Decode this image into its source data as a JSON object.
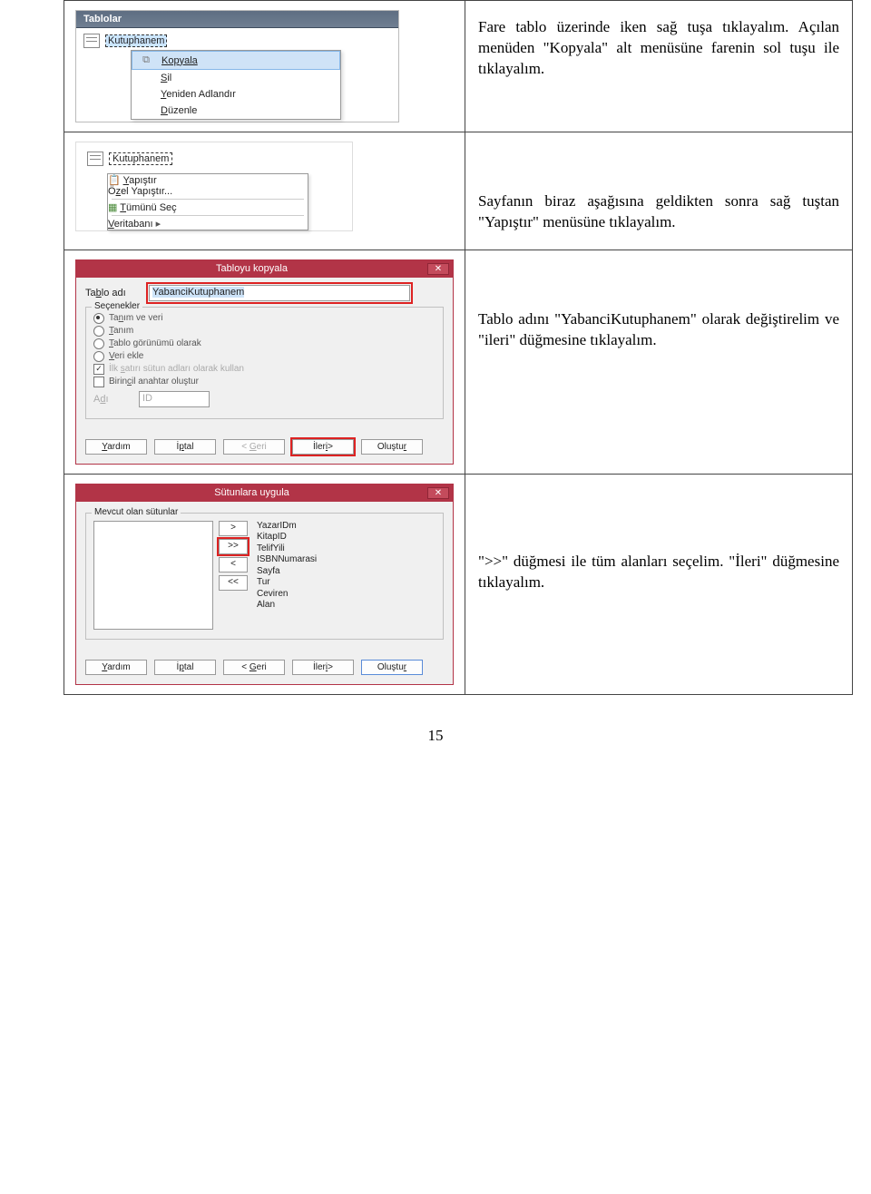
{
  "page_number": "15",
  "row1": {
    "instruction": "Fare tablo üzerinde iken sağ tuşa tıklayalım. Açılan menüden \"Kopyala\" alt menüsüne farenin sol tuşu ile tıklayalım.",
    "header": "Tablolar",
    "tree_item": "Kutuphanem",
    "menu": {
      "copy": "Kopyala",
      "del": "Sil",
      "rename": "Yeniden Adlandır",
      "edit": "Düzenle"
    }
  },
  "row2": {
    "instruction": "Sayfanın biraz aşağısına geldikten sonra sağ tuştan \"Yapıştır\" menüsüne tıklayalım.",
    "tree_item": "Kutuphanem",
    "menu": {
      "paste": "Yapıştır",
      "special": "Özel Yapıştır...",
      "selectall": "Tümünü Seç",
      "db": "Veritabanı"
    }
  },
  "row3": {
    "instruction": "Tablo adını \"YabanciKutuphanem\" olarak değiştirelim ve \"ileri\" düğmesine tıklayalım.",
    "dlg_title": "Tabloyu kopyala",
    "lbl_name": "Tablo adı",
    "value_name": "YabanciKutuphanem",
    "grp_title": "Seçenekler",
    "opts": {
      "o1": "Tanım ve veri",
      "o2": "Tanım",
      "o3": "Tablo görünümü olarak",
      "o4": "Veri ekle",
      "c1": "İlk satırı sütun adları olarak kullan",
      "c2": "Birincil anahtar oluştur"
    },
    "lbl_ad": "Adı",
    "value_ad": "ID",
    "buttons": {
      "help": "Yardım",
      "cancel": "İptal",
      "back": "< Geri",
      "next": "İleri>",
      "create": "Oluştur"
    }
  },
  "row4": {
    "instruction": "\">>\" düğmesi ile tüm alanları seçelim. \"İleri\" düğmesine tıklayalım.",
    "dlg_title": "Sütunlara uygula",
    "grp_title": "Mevcut olan sütunlar",
    "fields": [
      "YazarIDm",
      "KitapID",
      "TelifYili",
      "ISBNNumarasi",
      "Sayfa",
      "Tur",
      "Ceviren",
      "Alan"
    ],
    "mv": {
      "one_r": ">",
      "all_r": ">>",
      "one_l": "<",
      "all_l": "<<"
    },
    "buttons": {
      "help": "Yardım",
      "cancel": "İptal",
      "back": "< Geri",
      "next": "İleri>",
      "create": "Oluştur"
    }
  }
}
